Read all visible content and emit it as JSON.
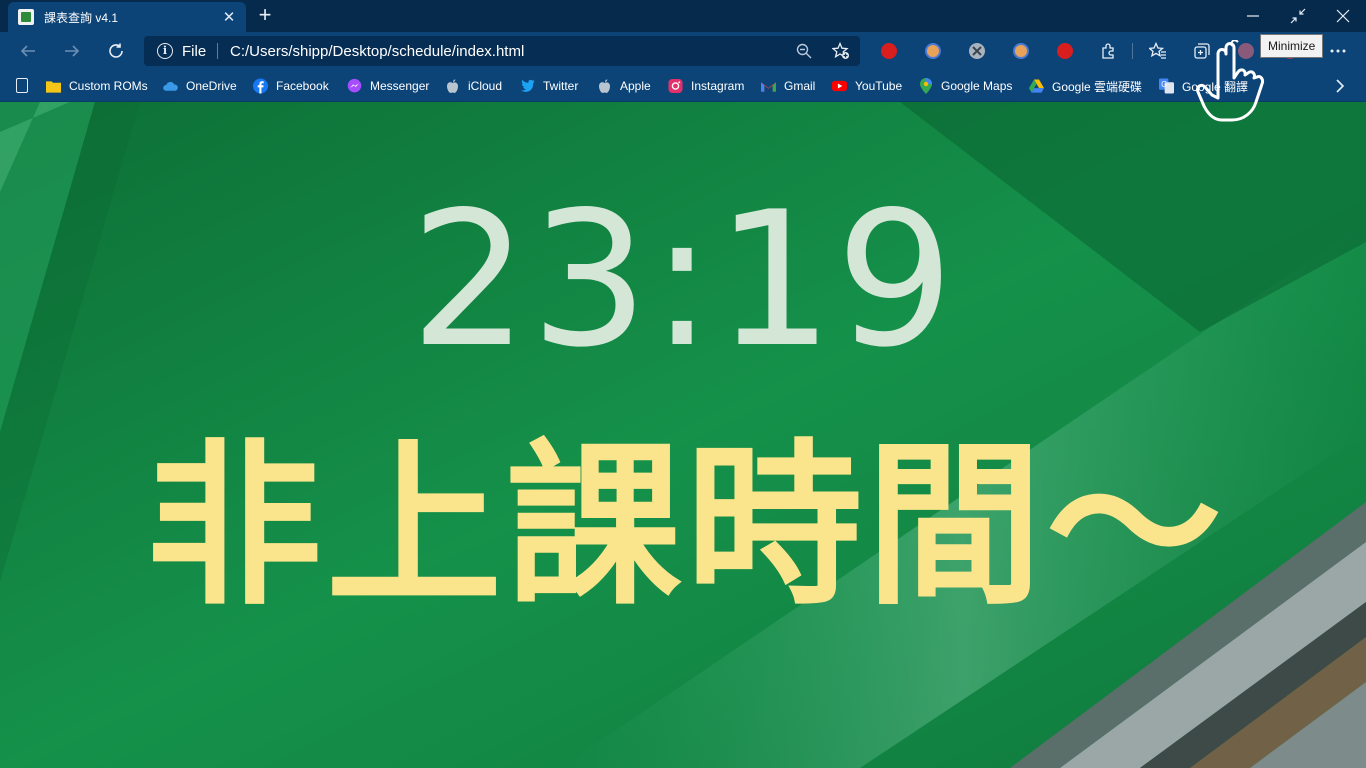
{
  "tab": {
    "title": "課表查詢 v4.1",
    "close_glyph": "✕"
  },
  "new_tab_glyph": "+",
  "window_controls": [
    "minimize-icon",
    "restore-icon",
    "close-icon"
  ],
  "address_bar": {
    "scheme_label": "File",
    "url": "C:/Users/shipp/Desktop/schedule/index.html"
  },
  "extensions": [
    "stop-hand-icon",
    "reading-glasses-icon",
    "x-circle-icon",
    "reading-glasses-icon",
    "stop-hand-icon",
    "puzzle-icon",
    "favorites-icon",
    "collections-icon",
    "profile-icon",
    "more-icon"
  ],
  "bookmarks": [
    {
      "label": "Custom ROMs",
      "icon": "folder-icon",
      "color": "#f5c518"
    },
    {
      "label": "OneDrive",
      "icon": "cloud-icon",
      "color": "#3a9ae8"
    },
    {
      "label": "Facebook",
      "icon": "facebook-icon",
      "color": "#1877f2"
    },
    {
      "label": "Messenger",
      "icon": "messenger-icon",
      "color": "#a64dff"
    },
    {
      "label": "iCloud",
      "icon": "apple-icon",
      "color": "#b8c4cf"
    },
    {
      "label": "Twitter",
      "icon": "twitter-icon",
      "color": "#1da1f2"
    },
    {
      "label": "Apple",
      "icon": "apple-icon",
      "color": "#b8c4cf"
    },
    {
      "label": "Instagram",
      "icon": "instagram-icon",
      "color": "#e1306c"
    },
    {
      "label": "Gmail",
      "icon": "gmail-icon",
      "color": "#ea4335"
    },
    {
      "label": "YouTube",
      "icon": "youtube-icon",
      "color": "#ff0000"
    },
    {
      "label": "Google Maps",
      "icon": "map-pin-icon",
      "color": "#34a853"
    },
    {
      "label": "Google 雲端硬碟",
      "icon": "drive-icon",
      "color": "#fbbc04"
    },
    {
      "label": "Google 翻譯",
      "icon": "translate-icon",
      "color": "#4285f4"
    }
  ],
  "page": {
    "clock": "23:19",
    "status": "非上課時間～"
  },
  "tooltip": "Minimize",
  "colors": {
    "frame": "#062a4c",
    "toolbar": "#0c4478",
    "page_bg": "#138b46",
    "clock_text": "#d4e6d6",
    "status_text": "#fbe58c"
  }
}
